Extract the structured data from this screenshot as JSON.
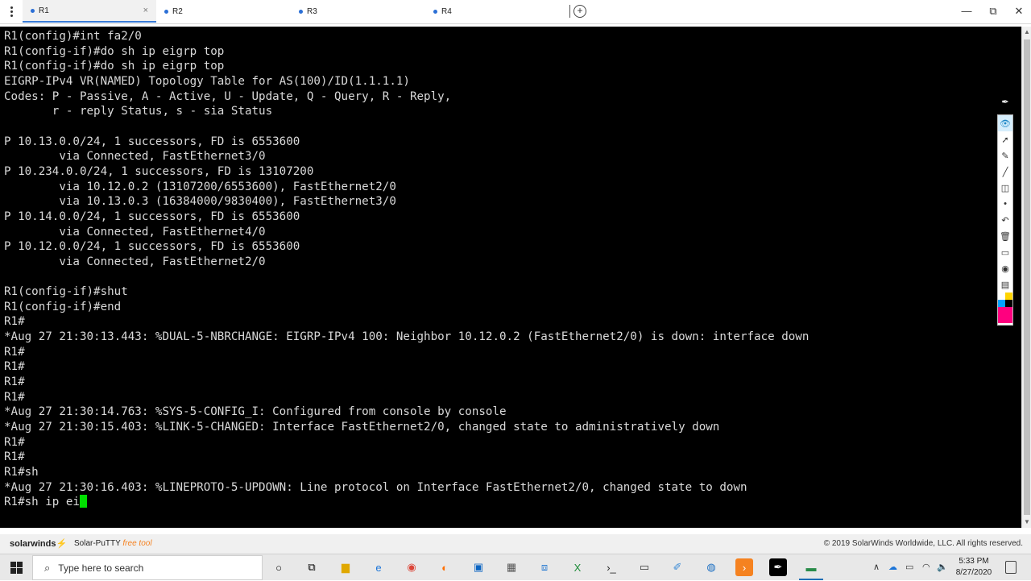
{
  "tabs": [
    {
      "label": "R1",
      "active": true,
      "close": "×"
    },
    {
      "label": "R2",
      "active": false
    },
    {
      "label": "R3",
      "active": false
    },
    {
      "label": "R4",
      "active": false
    }
  ],
  "window_controls": {
    "minimize": "—",
    "restore": "⧉",
    "close": "✕"
  },
  "terminal": {
    "lines": [
      "R1(config)#int fa2/0",
      "R1(config-if)#do sh ip eigrp top",
      "R1(config-if)#do sh ip eigrp top",
      "EIGRP-IPv4 VR(NAMED) Topology Table for AS(100)/ID(1.1.1.1)",
      "Codes: P - Passive, A - Active, U - Update, Q - Query, R - Reply,",
      "       r - reply Status, s - sia Status",
      "",
      "P 10.13.0.0/24, 1 successors, FD is 6553600",
      "        via Connected, FastEthernet3/0",
      "P 10.234.0.0/24, 1 successors, FD is 13107200",
      "        via 10.12.0.2 (13107200/6553600), FastEthernet2/0",
      "        via 10.13.0.3 (16384000/9830400), FastEthernet3/0",
      "P 10.14.0.0/24, 1 successors, FD is 6553600",
      "        via Connected, FastEthernet4/0",
      "P 10.12.0.0/24, 1 successors, FD is 6553600",
      "        via Connected, FastEthernet2/0",
      "",
      "R1(config-if)#shut",
      "R1(config-if)#end",
      "R1#",
      "*Aug 27 21:30:13.443: %DUAL-5-NBRCHANGE: EIGRP-IPv4 100: Neighbor 10.12.0.2 (FastEthernet2/0) is down: interface down",
      "R1#",
      "R1#",
      "R1#",
      "R1#",
      "*Aug 27 21:30:14.763: %SYS-5-CONFIG_I: Configured from console by console",
      "*Aug 27 21:30:15.403: %LINK-5-CHANGED: Interface FastEthernet2/0, changed state to administratively down",
      "R1#",
      "R1#",
      "R1#sh",
      "*Aug 27 21:30:16.403: %LINEPROTO-5-UPDOWN: Line protocol on Interface FastEthernet2/0, changed state to down"
    ],
    "current_input": "R1#sh ip ei"
  },
  "statusbar": {
    "brand": "solarwinds",
    "app_name": "Solar-PuTTY",
    "free_tool": "free tool",
    "copyright": "© 2019 SolarWinds Worldwide, LLC. All rights reserved."
  },
  "taskbar": {
    "search_placeholder": "Type here to search",
    "time": "5:33 PM",
    "date": "8/27/2020"
  },
  "colors": {
    "terminal_bg": "#000000",
    "terminal_fg": "#d9d9d9",
    "cursor": "#00e000",
    "tab_dot": "#2b6fd6",
    "accent_orange": "#f58220"
  },
  "icons": {
    "menu": "menu-icon",
    "new_tab": "add-tab-icon",
    "pen": "pen-icon",
    "search": "search-icon",
    "cortana": "cortana-icon",
    "task_view": "task-view-icon"
  }
}
